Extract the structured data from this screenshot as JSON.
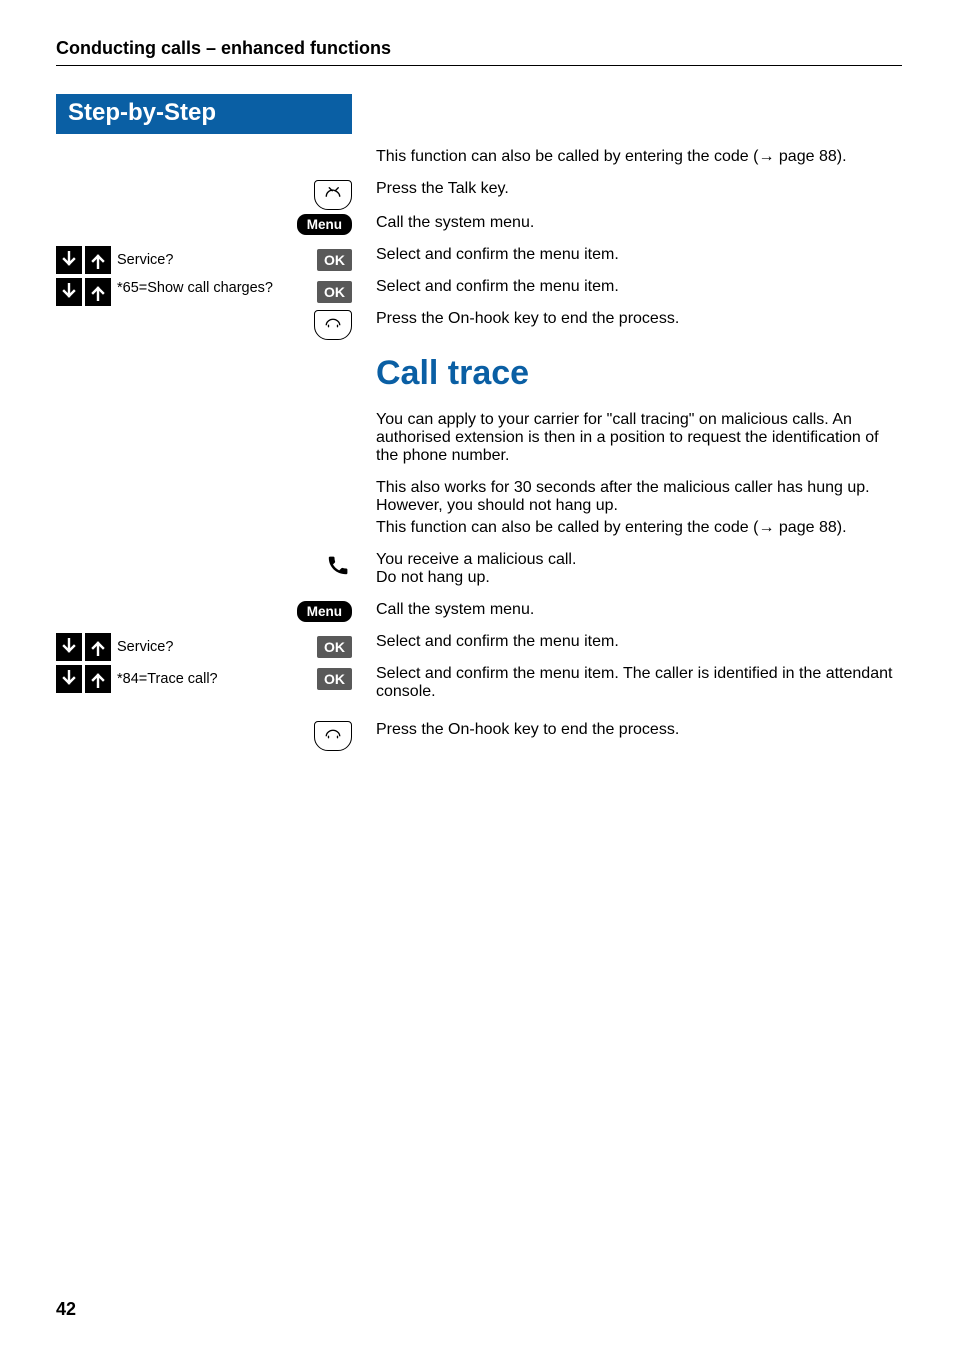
{
  "header": "Conducting calls – enhanced functions",
  "sidebar_title": "Step-by-Step",
  "labels": {
    "menu": "Menu",
    "ok": "OK",
    "service": "Service?",
    "show_charges": "*65=Show call charges?",
    "trace_call": "*84=Trace call?"
  },
  "body": {
    "p1a": "This function can also be called by entering the code (",
    "p1b": " page 88).",
    "press_talk": "Press the Talk key.",
    "call_menu": "Call the system menu.",
    "select_confirm": "Select and confirm the menu item.",
    "press_onhook": "Press the On-hook key to end the process.",
    "section_title": "Call trace",
    "ct_p1": "You can apply to your carrier for \"call tracing\" on malicious calls. An authorised extension is then in a position to request the identification of the phone number.",
    "ct_p2": "This also works for 30 seconds after the malicious caller has hung up. However, you should not hang up.",
    "ct_p3a": "This function can also be called by entering the code (",
    "ct_p3b": " page 88).",
    "receive_call_l1": "You receive a malicious call.",
    "receive_call_l2": "Do not hang up.",
    "select_confirm_trace": "Select and confirm the menu item. The caller is identified in the attendant console."
  },
  "page_number": "42"
}
